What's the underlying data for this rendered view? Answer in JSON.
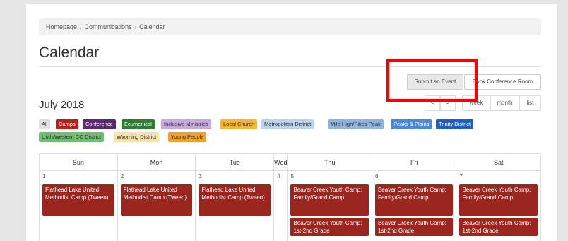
{
  "breadcrumb": {
    "items": [
      "Homepage",
      "Communications",
      "Calendar"
    ],
    "separator": "/"
  },
  "page_title": "Calendar",
  "buttons": {
    "submit_event": "Submit an Event",
    "book_room": "Book Conference Room"
  },
  "calendar": {
    "month_title": "July 2018",
    "nav": {
      "prev": "<",
      "next": ">"
    },
    "views": {
      "week": "week",
      "month": "month",
      "list": "list"
    },
    "weekdays": [
      "Sun",
      "Mon",
      "Tue",
      "Wed",
      "Thu",
      "Fri",
      "Sat"
    ],
    "days": [
      {
        "num": "1",
        "events": [
          "Flathead Lake United Methodist Camp (Tween)"
        ]
      },
      {
        "num": "2",
        "events": [
          "Flathead Lake United Methodist Camp (Tween)"
        ]
      },
      {
        "num": "3",
        "events": [
          "Flathead Lake United Methodist Camp (Tween)"
        ]
      },
      {
        "num": "4",
        "events": []
      },
      {
        "num": "5",
        "events": [
          "Beaver Creek Youth Camp: Family/Grand Camp",
          "Beaver Creek Youth Camp: 1st-2nd Grade"
        ]
      },
      {
        "num": "6",
        "events": [
          "Beaver Creek Youth Camp: Family/Grand Camp",
          "Beaver Creek Youth Camp: 1st-2nd Grade"
        ]
      },
      {
        "num": "7",
        "events": [
          "Beaver Creek Youth Camp: Family/Grand Camp",
          "Beaver Creek Youth Camp: 1st-2nd Grade"
        ]
      }
    ],
    "event_color": "#9b2620"
  },
  "filters": [
    {
      "label": "All",
      "bg": "#e0e0e0",
      "fg": "#333333"
    },
    {
      "label": "Camps",
      "bg": "#b3241e",
      "fg": "#ffffff"
    },
    {
      "label": "Conference",
      "bg": "#5b2a6e",
      "fg": "#ffffff"
    },
    {
      "label": "Ecumenical",
      "bg": "#2f7d32",
      "fg": "#ffffff"
    },
    {
      "label": "Inclusive Ministries",
      "bg": "#c9a8e0",
      "fg": "#333333"
    },
    {
      "label": "Local Church",
      "bg": "#f5b733",
      "fg": "#333333"
    },
    {
      "label": "Metropolitan District",
      "bg": "#bcd3ea",
      "fg": "#333333"
    },
    {
      "label": "Mile High/Pikes Peak",
      "bg": "#8fb4de",
      "fg": "#333333"
    },
    {
      "label": "Peaks & Plains",
      "bg": "#4a8ad4",
      "fg": "#ffffff"
    },
    {
      "label": "Trinity District",
      "bg": "#1f5fbf",
      "fg": "#ffffff"
    },
    {
      "label": "Utah/Western CO District",
      "bg": "#6fbf73",
      "fg": "#333333"
    },
    {
      "label": "Wyoming District",
      "bg": "#f7e3a6",
      "fg": "#333333"
    },
    {
      "label": "Young People",
      "bg": "#f0a030",
      "fg": "#333333"
    }
  ]
}
